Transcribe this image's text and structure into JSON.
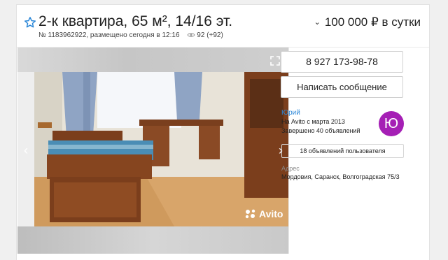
{
  "listing": {
    "title": "2-к квартира, 65 м², 14/16 эт.",
    "number_posted": "№ 1183962922, размещено сегодня в 12:16",
    "views": "92 (+92)",
    "price": "100 000 ₽ в сутки",
    "favorite_icon": "star-outline-icon",
    "colors": {
      "title_text": "#222222",
      "star": "#2d88d8"
    }
  },
  "gallery": {
    "watermark": "Avito",
    "expand_icon": "expand-icon",
    "prev_icon": "chevron-left-icon",
    "next_icon": "chevron-right-icon"
  },
  "seller": {
    "phone": "8 927 173-98-78",
    "write_message": "Написать сообщение",
    "name": "Юрий",
    "on_avito_since": "На Avito с марта 2013",
    "completed": "Завершено 40 объявлений",
    "avatar_letter": "Ю",
    "avatar_color": "#a51fb5",
    "user_ads_link": "18 объявлений пользователя",
    "name_color": "#2d88d8"
  },
  "address": {
    "label": "Адрес",
    "value": "Мордовия, Саранск, Волгоградская 75/3"
  }
}
